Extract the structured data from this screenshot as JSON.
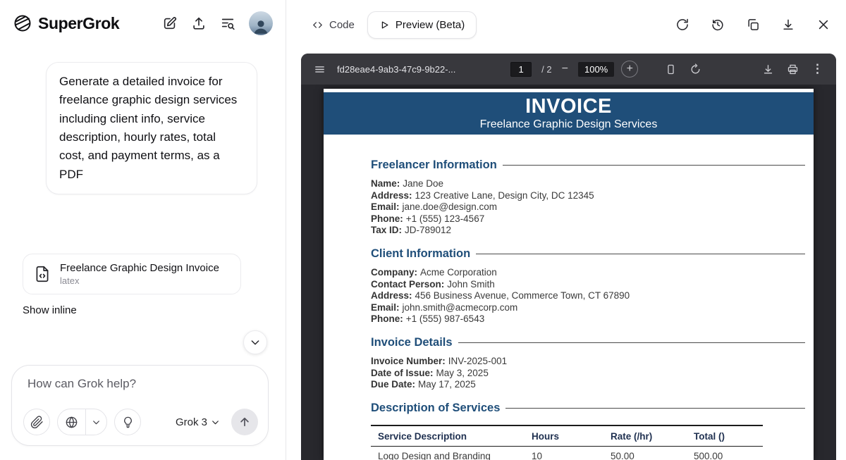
{
  "colors": {
    "invoice_blue": "#1f4e79",
    "pdf_toolbar_bg": "#38383d"
  },
  "left_panel": {
    "brand": "SuperGrok",
    "user_message": "Generate a detailed invoice for freelance graphic design services including client info, service description, hourly rates, total cost, and payment terms, as a PDF",
    "file_card": {
      "title": "Freelance Graphic Design Invoice",
      "subtitle": "latex"
    },
    "show_inline_label": "Show inline",
    "composer": {
      "placeholder": "How can Grok help?",
      "model_label": "Grok 3"
    }
  },
  "preview_panel": {
    "tabs": {
      "code": "Code",
      "preview": "Preview (Beta)"
    },
    "toolbar": {
      "filename": "fd28eae4-9ab3-47c9-9b22-...",
      "page": "1",
      "page_of": "/ 2",
      "zoom": "100%",
      "zoom_out_glyph": "−",
      "zoom_in_glyph": "+",
      "more_glyph": "⋮"
    },
    "invoice": {
      "title": "INVOICE",
      "subtitle": "Freelance Graphic Design Services",
      "sections": [
        {
          "heading": "Freelancer Information",
          "fields": [
            {
              "label": "Name:",
              "value": "Jane Doe"
            },
            {
              "label": "Address:",
              "value": "123 Creative Lane, Design City, DC 12345"
            },
            {
              "label": "Email:",
              "value": "jane.doe@design.com"
            },
            {
              "label": "Phone:",
              "value": "+1 (555) 123-4567"
            },
            {
              "label": "Tax ID:",
              "value": "JD-789012"
            }
          ]
        },
        {
          "heading": "Client Information",
          "fields": [
            {
              "label": "Company:",
              "value": "Acme Corporation"
            },
            {
              "label": "Contact Person:",
              "value": "John Smith"
            },
            {
              "label": "Address:",
              "value": "456 Business Avenue, Commerce Town, CT 67890"
            },
            {
              "label": "Email:",
              "value": "john.smith@acmecorp.com"
            },
            {
              "label": "Phone:",
              "value": "+1 (555) 987-6543"
            }
          ]
        },
        {
          "heading": "Invoice Details",
          "fields": [
            {
              "label": "Invoice Number:",
              "value": "INV-2025-001"
            },
            {
              "label": "Date of Issue:",
              "value": "May 3, 2025"
            },
            {
              "label": "Due Date:",
              "value": "May 17, 2025"
            }
          ]
        },
        {
          "heading": "Description of Services",
          "fields": []
        }
      ],
      "table": {
        "headers": [
          "Service Description",
          "Hours",
          "Rate (/hr)",
          "Total ()"
        ],
        "rows": [
          [
            "Logo Design and Branding",
            "10",
            "50.00",
            "500.00"
          ]
        ]
      }
    }
  }
}
